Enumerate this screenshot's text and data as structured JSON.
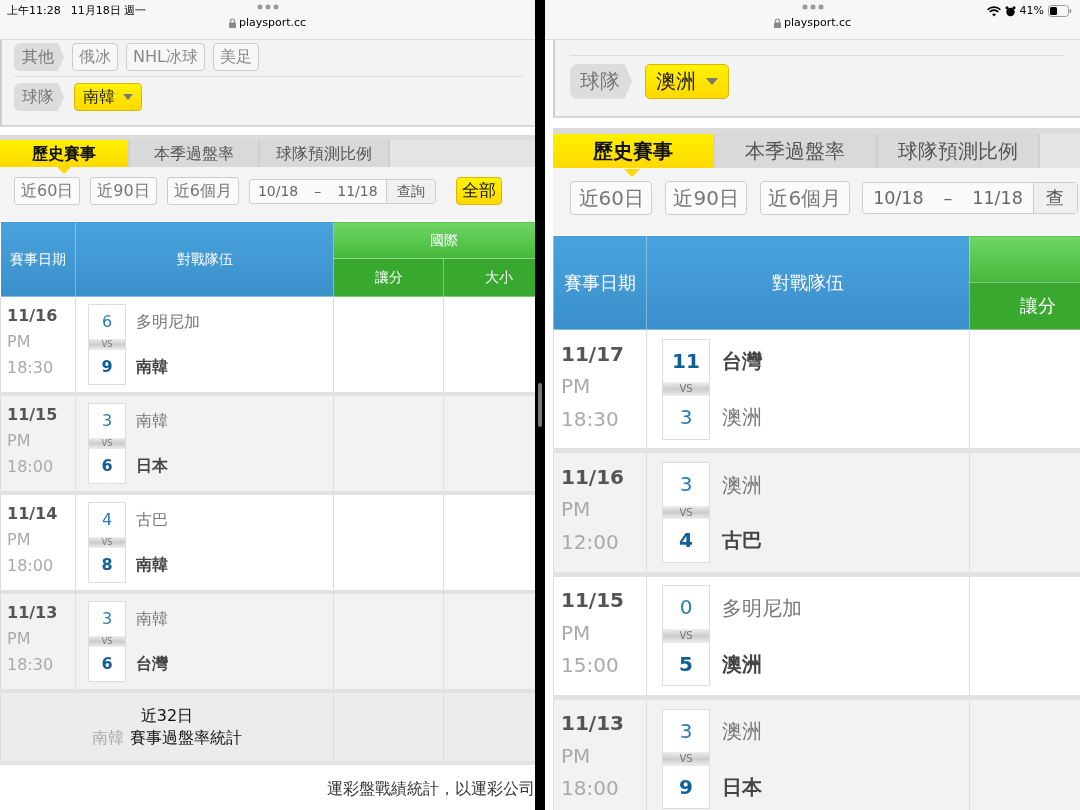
{
  "panes": [
    {
      "status": {
        "time": "上午11:28",
        "date": "11月18日 週一"
      },
      "url": "playsport.cc",
      "filter": {
        "chip_label": "其他",
        "chips": [
          "俄冰",
          "NHL冰球",
          "美足"
        ],
        "team_label": "球隊",
        "team": "南韓"
      },
      "tabs": [
        {
          "label": "歷史賽事",
          "selected": true
        },
        {
          "label": "本季過盤率",
          "selected": false
        },
        {
          "label": "球隊預測比例",
          "selected": false
        }
      ],
      "ranges": [
        "近60日",
        "近90日",
        "近6個月"
      ],
      "date_from": "10/18",
      "date_separator": "–",
      "date_to": "11/18",
      "query": "查詢",
      "all_button": "全部",
      "columns": {
        "date": "賽事日期",
        "teams": "對戰隊伍",
        "group": "國際",
        "sub": [
          "讓分",
          "大小"
        ]
      },
      "rows": [
        {
          "date": "11/16",
          "period": "PM",
          "time": "18:30",
          "vs": "VS",
          "teams": [
            {
              "score": "6",
              "name": "多明尼加",
              "winner": false
            },
            {
              "score": "9",
              "name": "南韓",
              "winner": true
            }
          ]
        },
        {
          "date": "11/15",
          "period": "PM",
          "time": "18:00",
          "vs": "VS",
          "teams": [
            {
              "score": "3",
              "name": "南韓",
              "winner": false
            },
            {
              "score": "6",
              "name": "日本",
              "winner": true
            }
          ]
        },
        {
          "date": "11/14",
          "period": "PM",
          "time": "18:00",
          "vs": "VS",
          "teams": [
            {
              "score": "4",
              "name": "古巴",
              "winner": false
            },
            {
              "score": "8",
              "name": "南韓",
              "winner": true
            }
          ]
        },
        {
          "date": "11/13",
          "period": "PM",
          "time": "18:30",
          "vs": "VS",
          "teams": [
            {
              "score": "3",
              "name": "南韓",
              "winner": false
            },
            {
              "score": "6",
              "name": "台灣",
              "winner": true
            }
          ]
        }
      ],
      "summary": {
        "period": "近32日",
        "team": "南韓",
        "label": "賽事過盤率統計"
      },
      "footer_note": "運彩盤戰績統計，以運彩公司"
    },
    {
      "status": {
        "battery": "41%"
      },
      "url": "playsport.cc",
      "filter": {
        "team_label": "球隊",
        "team": "澳洲"
      },
      "tabs": [
        {
          "label": "歷史賽事",
          "selected": true
        },
        {
          "label": "本季過盤率",
          "selected": false
        },
        {
          "label": "球隊預測比例",
          "selected": false
        }
      ],
      "ranges": [
        "近60日",
        "近90日",
        "近6個月"
      ],
      "date_from": "10/18",
      "date_separator": "–",
      "date_to": "11/18",
      "query": "查",
      "columns": {
        "date": "賽事日期",
        "teams": "對戰隊伍",
        "sub": [
          "讓分"
        ]
      },
      "rows": [
        {
          "date": "11/17",
          "period": "PM",
          "time": "18:30",
          "vs": "VS",
          "teams": [
            {
              "score": "11",
              "name": "台灣",
              "winner": true
            },
            {
              "score": "3",
              "name": "澳洲",
              "winner": false
            }
          ]
        },
        {
          "date": "11/16",
          "period": "PM",
          "time": "12:00",
          "vs": "VS",
          "teams": [
            {
              "score": "3",
              "name": "澳洲",
              "winner": false
            },
            {
              "score": "4",
              "name": "古巴",
              "winner": true
            }
          ]
        },
        {
          "date": "11/15",
          "period": "PM",
          "time": "15:00",
          "vs": "VS",
          "teams": [
            {
              "score": "0",
              "name": "多明尼加",
              "winner": false
            },
            {
              "score": "5",
              "name": "澳洲",
              "winner": true
            }
          ]
        },
        {
          "date": "11/13",
          "period": "PM",
          "time": "18:00",
          "vs": "VS",
          "teams": [
            {
              "score": "3",
              "name": "澳洲",
              "winner": false
            },
            {
              "score": "9",
              "name": "日本",
              "winner": true
            }
          ]
        }
      ]
    }
  ]
}
